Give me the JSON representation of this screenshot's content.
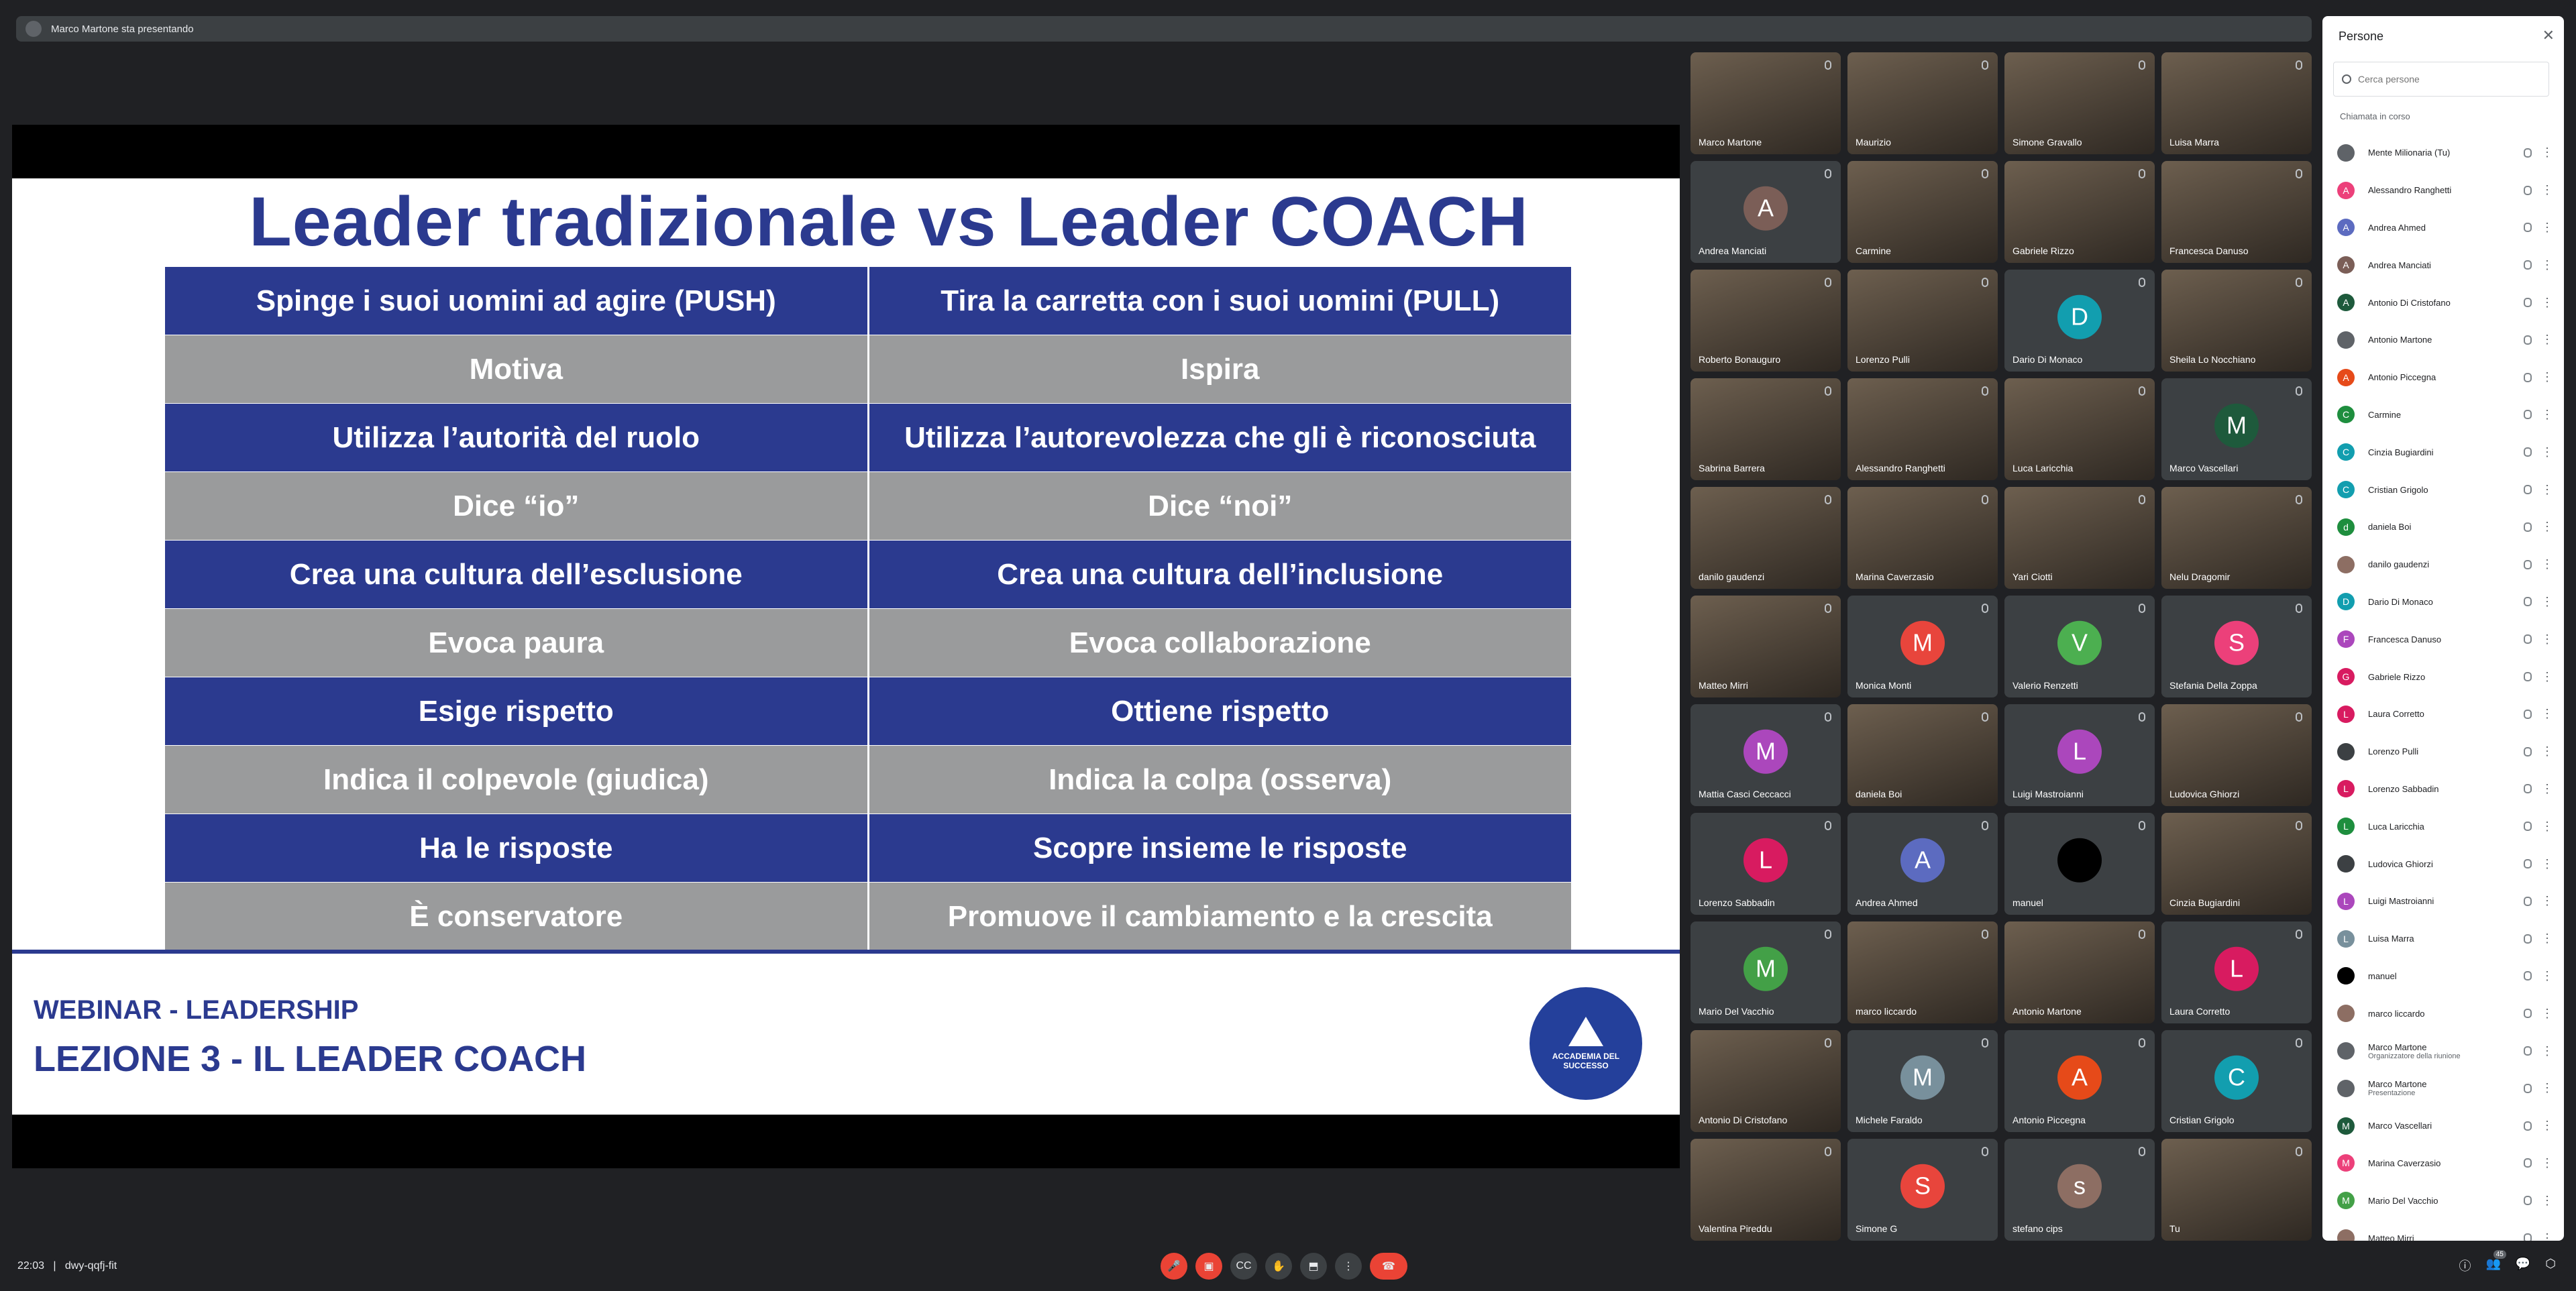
{
  "presenter_bar": {
    "text": "Marco Martone sta presentando"
  },
  "slide": {
    "title": "Leader tradizionale vs Leader COACH",
    "rows": [
      {
        "style": "blue",
        "left": "Spinge i suoi uomini ad agire (PUSH)",
        "right": "Tira la carretta con i suoi uomini (PULL)"
      },
      {
        "style": "gray",
        "left": "Motiva",
        "right": "Ispira"
      },
      {
        "style": "blue",
        "left": "Utilizza l’autorità del ruolo",
        "right": "Utilizza l’autorevolezza che gli è riconosciuta"
      },
      {
        "style": "gray",
        "left": "Dice “io”",
        "right": "Dice “noi”"
      },
      {
        "style": "blue",
        "left": "Crea una cultura dell’esclusione",
        "right": "Crea una cultura dell’inclusione"
      },
      {
        "style": "gray",
        "left": "Evoca paura",
        "right": "Evoca collaborazione"
      },
      {
        "style": "blue",
        "left": "Esige rispetto",
        "right": "Ottiene rispetto"
      },
      {
        "style": "gray",
        "left": "Indica il colpevole (giudica)",
        "right": "Indica la colpa (osserva)"
      },
      {
        "style": "blue",
        "left": "Ha le risposte",
        "right": "Scopre insieme le risposte"
      },
      {
        "style": "gray",
        "left": "È conservatore",
        "right": "Promuove il cambiamento e la crescita"
      }
    ],
    "footer_subtitle": "WEBINAR - LEADERSHIP",
    "footer_title": "LEZIONE 3 - IL LEADER COACH",
    "logo_text": "ACCADEMIA DEL SUCCESSO"
  },
  "tiles": [
    {
      "name": "Marco Martone",
      "video": true
    },
    {
      "name": "Maurizio",
      "video": true
    },
    {
      "name": "Simone Gravallo",
      "video": true
    },
    {
      "name": "Luisa Marra",
      "video": true
    },
    {
      "name": "Andrea Manciati",
      "initial": "A",
      "color": "#7b5e57"
    },
    {
      "name": "Carmine",
      "video": true
    },
    {
      "name": "Gabriele Rizzo",
      "video": true
    },
    {
      "name": "Francesca Danuso",
      "video": true
    },
    {
      "name": "Roberto Bonauguro",
      "video": true
    },
    {
      "name": "Lorenzo Pulli",
      "video": true
    },
    {
      "name": "Dario Di Monaco",
      "initial": "D",
      "color": "#129eaf"
    },
    {
      "name": "Sheila Lo Nocchiano",
      "video": true
    },
    {
      "name": "Sabrina Barrera",
      "video": true
    },
    {
      "name": "Alessandro Ranghetti",
      "video": true
    },
    {
      "name": "Luca Laricchia",
      "video": true
    },
    {
      "name": "Marco Vascellari",
      "initial": "M",
      "color": "#1e5a3c"
    },
    {
      "name": "danilo gaudenzi",
      "video": true
    },
    {
      "name": "Marina Caverzasio",
      "video": true
    },
    {
      "name": "Yari Ciotti",
      "video": true
    },
    {
      "name": "Nelu Dragomir",
      "video": true
    },
    {
      "name": "Matteo Mirri",
      "video": true
    },
    {
      "name": "Monica Monti",
      "initial": "M",
      "color": "#e8453c"
    },
    {
      "name": "Valerio Renzetti",
      "initial": "V",
      "color": "#4caf50"
    },
    {
      "name": "Stefania Della Zoppa",
      "initial": "S",
      "color": "#ec407a"
    },
    {
      "name": "Mattia Casci Ceccacci",
      "initial": "M",
      "color": "#ab47bc"
    },
    {
      "name": "daniela Boi",
      "video": true
    },
    {
      "name": "Luigi Mastroianni",
      "initial": "L",
      "color": "#ab47bc"
    },
    {
      "name": "Ludovica Ghiorzi",
      "video": true
    },
    {
      "name": "Lorenzo Sabbadin",
      "initial": "L",
      "color": "#d81b60"
    },
    {
      "name": "Andrea Ahmed",
      "initial": "A",
      "color": "#5c6bc0"
    },
    {
      "name": "manuel",
      "initial": "",
      "color": "#000000"
    },
    {
      "name": "Cinzia Bugiardini",
      "video": true
    },
    {
      "name": "Mario Del Vacchio",
      "initial": "M",
      "color": "#43a047"
    },
    {
      "name": "marco liccardo",
      "video": true
    },
    {
      "name": "Antonio Martone",
      "video": true
    },
    {
      "name": "Laura Corretto",
      "initial": "L",
      "color": "#d81b60"
    },
    {
      "name": "Antonio Di Cristofano",
      "video": true
    },
    {
      "name": "Michele Faraldo",
      "initial": "M",
      "color": "#78909c"
    },
    {
      "name": "Antonio Piccegna",
      "initial": "A",
      "color": "#e64a19"
    },
    {
      "name": "Cristian Grigolo",
      "initial": "C",
      "color": "#129eaf"
    },
    {
      "name": "Valentina Pireddu",
      "video": true
    },
    {
      "name": "Simone G",
      "initial": "S",
      "color": "#e8453c"
    },
    {
      "name": "stefano cips",
      "initial": "s",
      "color": "#8d6e63"
    },
    {
      "name": "Tu",
      "video": true
    }
  ],
  "panel": {
    "title": "Persone",
    "search_placeholder": "Cerca persone",
    "section": "Chiamata in corso",
    "people": [
      {
        "name": "Mente Milionaria (Tu)",
        "initial": "",
        "color": "#5f6368"
      },
      {
        "name": "Alessandro Ranghetti",
        "initial": "A",
        "color": "#ec407a"
      },
      {
        "name": "Andrea Ahmed",
        "initial": "A",
        "color": "#5c6bc0"
      },
      {
        "name": "Andrea Manciati",
        "initial": "A",
        "color": "#7b5e57"
      },
      {
        "name": "Antonio Di Cristofano",
        "initial": "A",
        "color": "#1e5a3c"
      },
      {
        "name": "Antonio Martone",
        "initial": "",
        "color": "#5f6368"
      },
      {
        "name": "Antonio Piccegna",
        "initial": "A",
        "color": "#e64a19"
      },
      {
        "name": "Carmine",
        "initial": "C",
        "color": "#1e8e3e"
      },
      {
        "name": "Cinzia Bugiardini",
        "initial": "C",
        "color": "#129eaf"
      },
      {
        "name": "Cristian Grigolo",
        "initial": "C",
        "color": "#129eaf"
      },
      {
        "name": "daniela Boi",
        "initial": "d",
        "color": "#1e8e3e"
      },
      {
        "name": "danilo gaudenzi",
        "initial": "",
        "color": "#8d6e63"
      },
      {
        "name": "Dario Di Monaco",
        "initial": "D",
        "color": "#129eaf"
      },
      {
        "name": "Francesca Danuso",
        "initial": "F",
        "color": "#ab47bc"
      },
      {
        "name": "Gabriele Rizzo",
        "initial": "G",
        "color": "#d81b60"
      },
      {
        "name": "Laura Corretto",
        "initial": "L",
        "color": "#d81b60"
      },
      {
        "name": "Lorenzo Pulli",
        "initial": "",
        "color": "#3c4043"
      },
      {
        "name": "Lorenzo Sabbadin",
        "initial": "L",
        "color": "#d81b60"
      },
      {
        "name": "Luca Laricchia",
        "initial": "L",
        "color": "#1e8e3e"
      },
      {
        "name": "Ludovica Ghiorzi",
        "initial": "",
        "color": "#3c4043"
      },
      {
        "name": "Luigi Mastroianni",
        "initial": "L",
        "color": "#ab47bc"
      },
      {
        "name": "Luisa Marra",
        "initial": "L",
        "color": "#78909c"
      },
      {
        "name": "manuel",
        "initial": "",
        "color": "#000000"
      },
      {
        "name": "marco liccardo",
        "initial": "",
        "color": "#8d6e63"
      },
      {
        "name": "Marco Martone",
        "sub": "Organizzatore della riunione",
        "initial": "",
        "color": "#5f6368"
      },
      {
        "name": "Marco Martone",
        "sub": "Presentazione",
        "initial": "",
        "color": "#5f6368"
      },
      {
        "name": "Marco Vascellari",
        "initial": "M",
        "color": "#1e5a3c"
      },
      {
        "name": "Marina Caverzasio",
        "initial": "M",
        "color": "#ec407a"
      },
      {
        "name": "Mario Del Vacchio",
        "initial": "M",
        "color": "#43a047"
      },
      {
        "name": "Matteo Mirri",
        "initial": "",
        "color": "#8d6e63"
      }
    ]
  },
  "bottom": {
    "time": "22:03",
    "meeting_code": "dwy-qqfj-fit",
    "participants_badge": "45",
    "accent_end": "#ea4335"
  }
}
